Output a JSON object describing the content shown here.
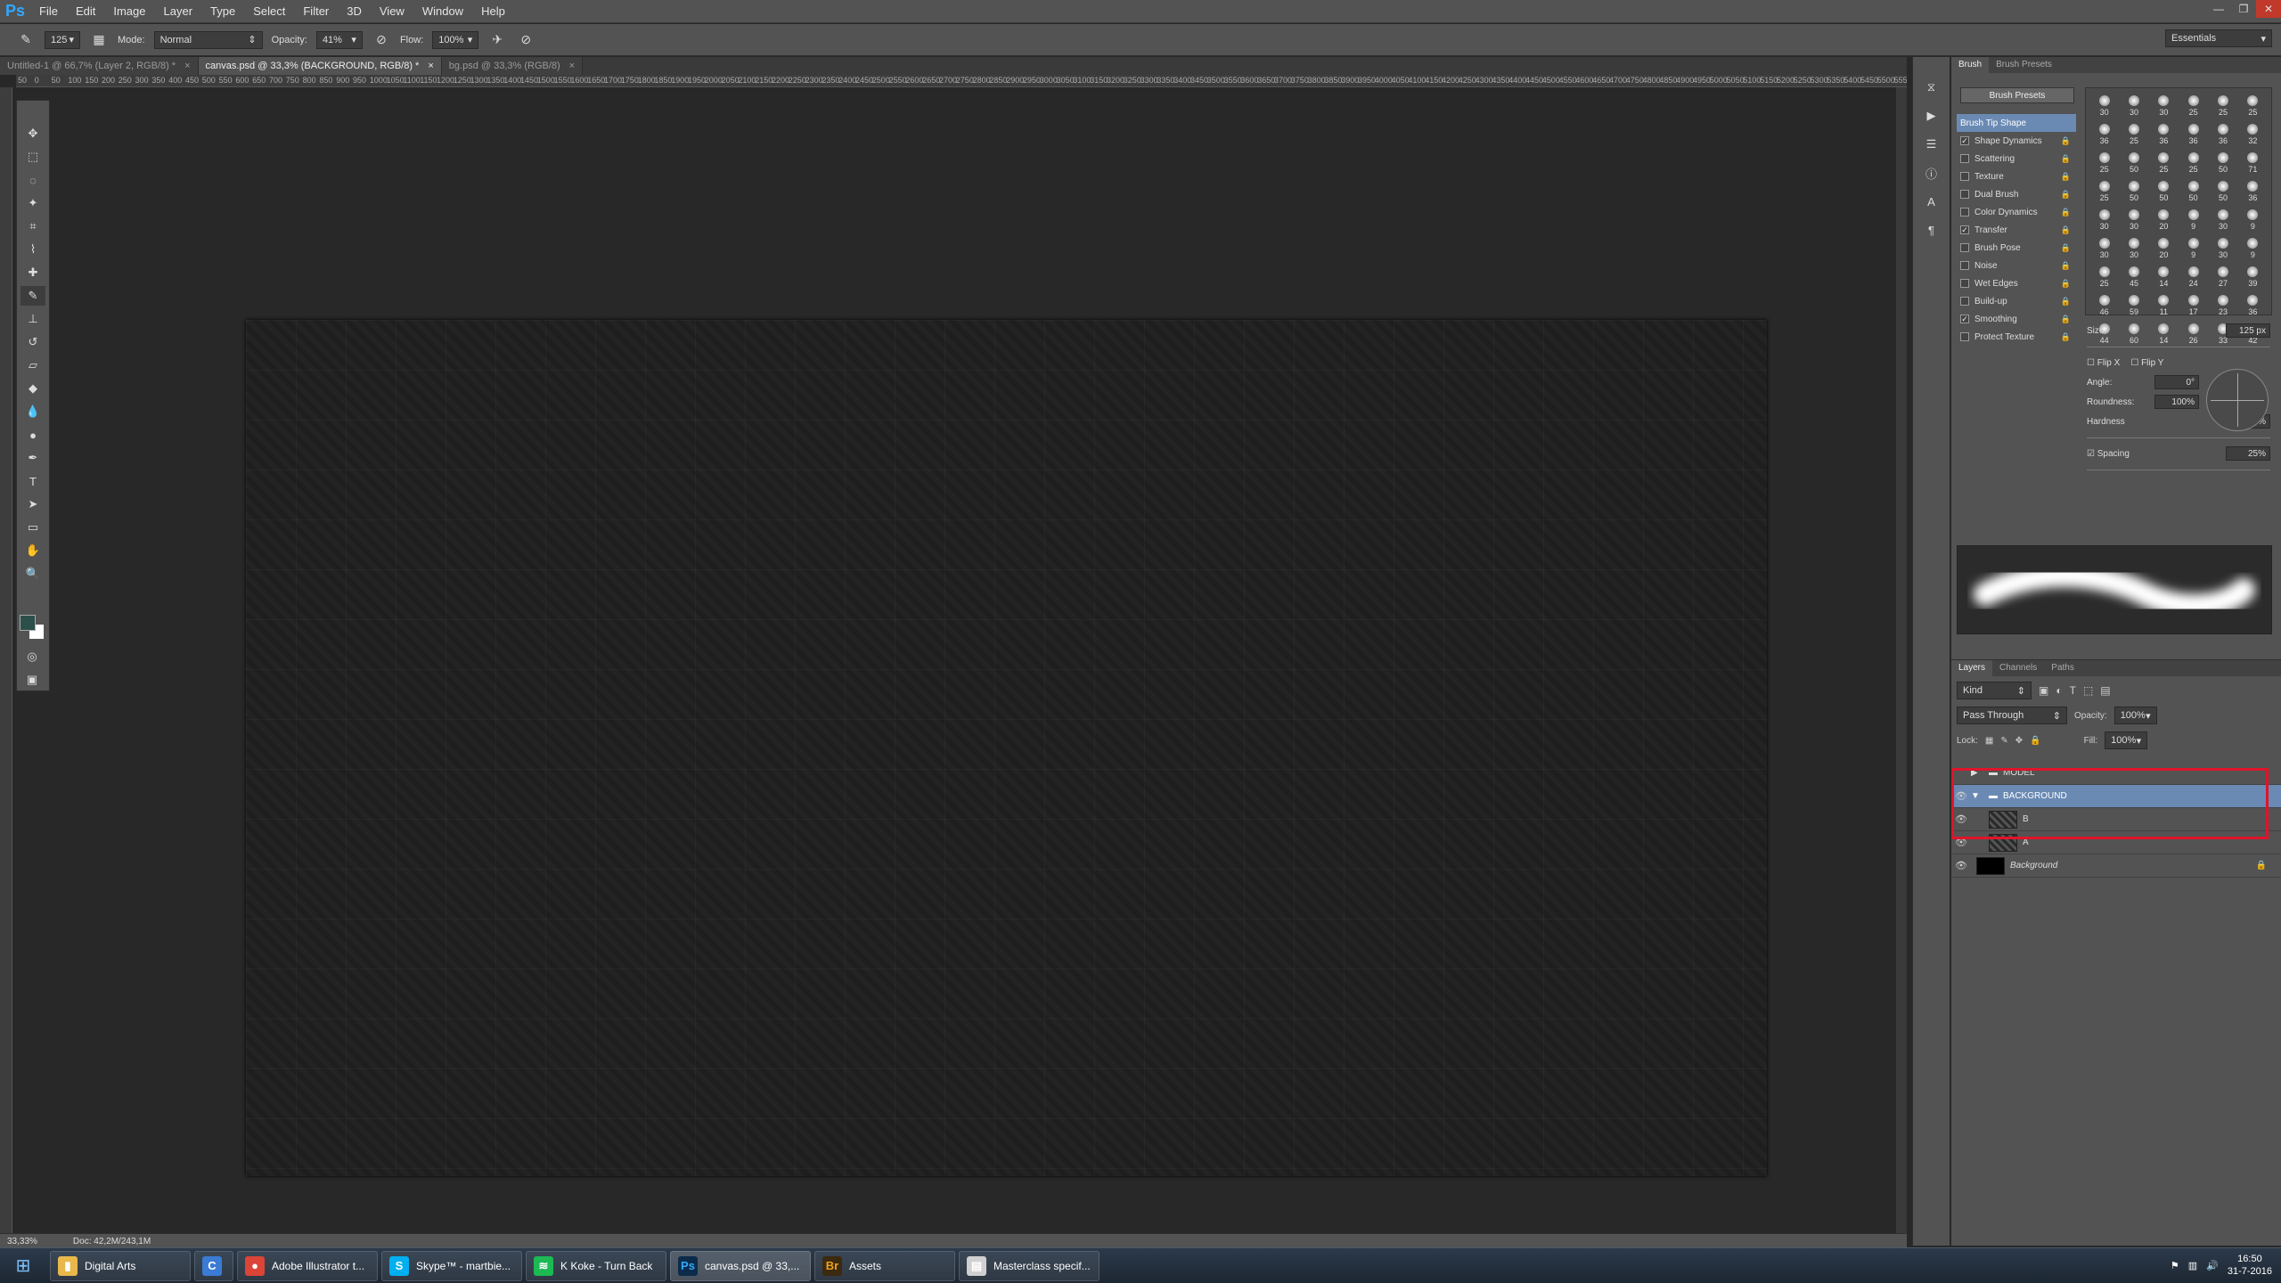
{
  "app": {
    "logo": "Ps",
    "menus": [
      "File",
      "Edit",
      "Image",
      "Layer",
      "Type",
      "Select",
      "Filter",
      "3D",
      "View",
      "Window",
      "Help"
    ],
    "workspace": "Essentials"
  },
  "options": {
    "brush_size": "125",
    "mode_label": "Mode:",
    "mode": "Normal",
    "opacity_label": "Opacity:",
    "opacity": "41%",
    "flow_label": "Flow:",
    "flow": "100%"
  },
  "tabs": [
    {
      "label": "Untitled-1 @ 66,7% (Layer 2, RGB/8) *"
    },
    {
      "label": "canvas.psd @ 33,3% (BACKGROUND, RGB/8) *"
    },
    {
      "label": "bg.psd @ 33,3% (RGB/8)"
    }
  ],
  "ruler_ticks": [
    "50",
    "0",
    "50",
    "100",
    "150",
    "200",
    "250",
    "300",
    "350",
    "400",
    "450",
    "500",
    "550",
    "600",
    "650",
    "700",
    "750",
    "800",
    "850",
    "900",
    "950",
    "1000",
    "1050",
    "1100",
    "1150",
    "1200",
    "1250",
    "1300",
    "1350",
    "1400",
    "1450",
    "1500",
    "1550",
    "1600",
    "1650",
    "1700",
    "1750",
    "1800",
    "1850",
    "1900",
    "1950",
    "2000",
    "2050",
    "2100",
    "2150",
    "2200",
    "2250",
    "2300",
    "2350",
    "2400",
    "2450",
    "2500",
    "2550",
    "2600",
    "2650",
    "2700",
    "2750",
    "2800",
    "2850",
    "2900",
    "2950",
    "3000",
    "3050",
    "3100",
    "3150",
    "3200",
    "3250",
    "3300",
    "3350",
    "3400",
    "3450",
    "3500",
    "3550",
    "3600",
    "3650",
    "3700",
    "3750",
    "3800",
    "3850",
    "3900",
    "3950",
    "4000",
    "4050",
    "4100",
    "4150",
    "4200",
    "4250",
    "4300",
    "4350",
    "4400",
    "4450",
    "4500",
    "4550",
    "4600",
    "4650",
    "4700",
    "4750",
    "4800",
    "4850",
    "4900",
    "4950",
    "5000",
    "5050",
    "5100",
    "5150",
    "5200",
    "5250",
    "5300",
    "5350",
    "5400",
    "5450",
    "5500",
    "5550"
  ],
  "status": {
    "zoom": "33,33%",
    "doc": "Doc: 42,2M/243,1M"
  },
  "brush_panel": {
    "tabs": [
      "Brush",
      "Brush Presets"
    ],
    "presets_button": "Brush Presets",
    "options": [
      {
        "label": "Brush Tip Shape",
        "checked": "",
        "selected": true
      },
      {
        "label": "Shape Dynamics",
        "checked": "✓"
      },
      {
        "label": "Scattering",
        "checked": ""
      },
      {
        "label": "Texture",
        "checked": ""
      },
      {
        "label": "Dual Brush",
        "checked": ""
      },
      {
        "label": "Color Dynamics",
        "checked": ""
      },
      {
        "label": "Transfer",
        "checked": "✓"
      },
      {
        "label": "Brush Pose",
        "checked": ""
      },
      {
        "label": "Noise",
        "checked": ""
      },
      {
        "label": "Wet Edges",
        "checked": ""
      },
      {
        "label": "Build-up",
        "checked": ""
      },
      {
        "label": "Smoothing",
        "checked": "✓"
      },
      {
        "label": "Protect Texture",
        "checked": ""
      }
    ],
    "grid_sizes": [
      "30",
      "30",
      "30",
      "25",
      "25",
      "25",
      "36",
      "25",
      "36",
      "36",
      "36",
      "32",
      "25",
      "50",
      "25",
      "25",
      "50",
      "71",
      "25",
      "50",
      "50",
      "50",
      "50",
      "36",
      "30",
      "30",
      "20",
      "9",
      "30",
      "9",
      "30",
      "30",
      "20",
      "9",
      "30",
      "9",
      "25",
      "45",
      "14",
      "24",
      "27",
      "39",
      "46",
      "59",
      "11",
      "17",
      "23",
      "36",
      "44",
      "60",
      "14",
      "26",
      "33",
      "42"
    ],
    "size_label": "Size",
    "size": "125 px",
    "flipx": "Flip X",
    "flipy": "Flip Y",
    "angle_label": "Angle:",
    "angle": "0°",
    "roundness_label": "Roundness:",
    "roundness": "100%",
    "hardness_label": "Hardness",
    "hardness": "0%",
    "spacing_label": "Spacing",
    "spacing": "25%"
  },
  "layers_panel": {
    "tabs": [
      "Layers",
      "Channels",
      "Paths"
    ],
    "filter": "Kind",
    "blend": "Pass Through",
    "opacity_label": "Opacity:",
    "opacity": "100%",
    "lock_label": "Lock:",
    "fill_label": "Fill:",
    "fill": "100%",
    "layers": [
      {
        "name": "MODEL",
        "type": "group"
      },
      {
        "name": "BACKGROUND",
        "type": "group-open"
      },
      {
        "name": "B",
        "type": "layer"
      },
      {
        "name": "A",
        "type": "layer"
      },
      {
        "name": "Background",
        "type": "bg"
      }
    ]
  },
  "taskbar": {
    "items": [
      {
        "label": "Digital Arts",
        "icon": "folder-icon",
        "color": "#e8b84a",
        "glyph": "▮"
      },
      {
        "label": "",
        "icon": "ccleaner-icon",
        "color": "#3a7bd5",
        "glyph": "C"
      },
      {
        "label": "Adobe Illustrator t...",
        "icon": "chrome-icon",
        "color": "#db4437",
        "glyph": "●"
      },
      {
        "label": "Skype™ - martbie...",
        "icon": "skype-icon",
        "color": "#00aff0",
        "glyph": "S"
      },
      {
        "label": "K Koke - Turn Back",
        "icon": "spotify-icon",
        "color": "#1db954",
        "glyph": "≋"
      },
      {
        "label": "canvas.psd @ 33,...",
        "icon": "photoshop-icon",
        "color": "#0c2b4a",
        "glyph": "Ps"
      },
      {
        "label": "Assets",
        "icon": "bridge-icon",
        "color": "#3b2a10",
        "glyph": "Br"
      },
      {
        "label": "Masterclass specif...",
        "icon": "document-icon",
        "color": "#d0d0d0",
        "glyph": "▤"
      }
    ],
    "time": "16:50",
    "date": "31-7-2016"
  }
}
